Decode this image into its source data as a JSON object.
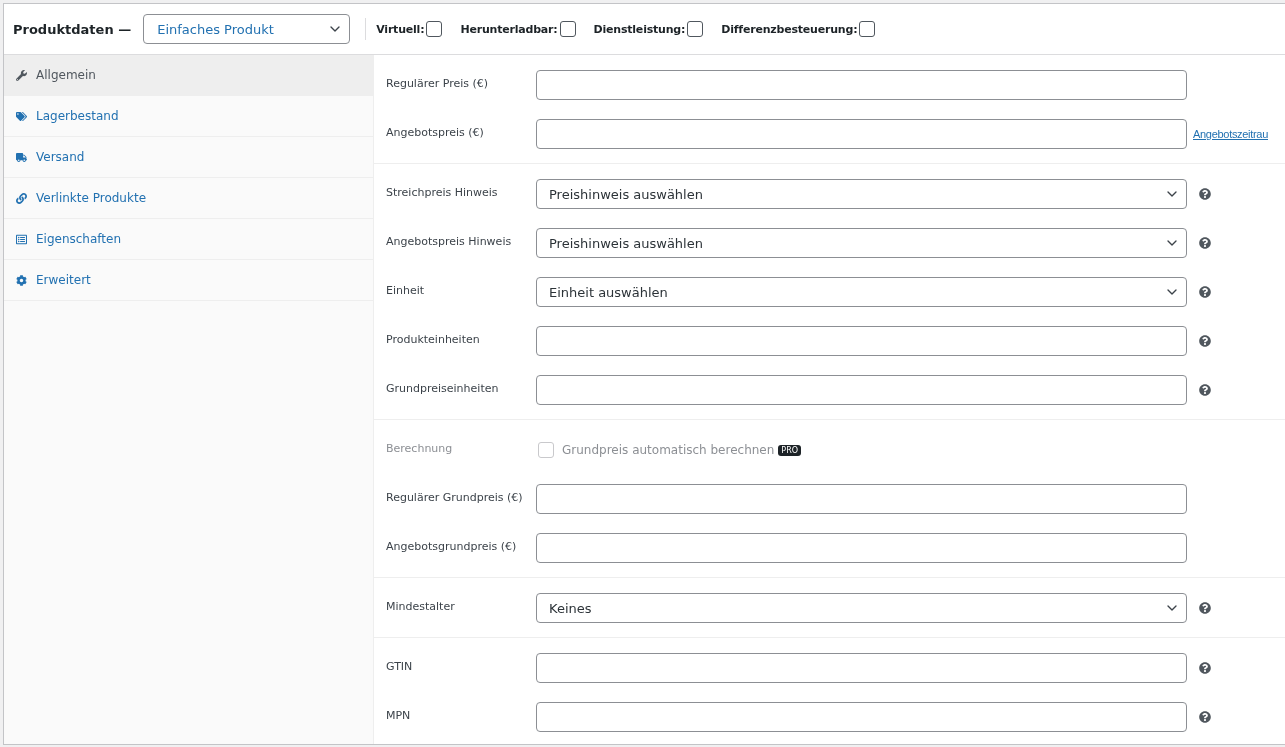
{
  "header": {
    "title": "Produktdaten —",
    "product_type": "Einfaches Produkt",
    "options": [
      {
        "label": "Virtuell:",
        "checked": false
      },
      {
        "label": "Herunterladbar:",
        "checked": false
      },
      {
        "label": "Dienstleistung:",
        "checked": false
      },
      {
        "label": "Differenzbesteuerung:",
        "checked": false
      }
    ]
  },
  "sidebar": {
    "items": [
      {
        "label": "Allgemein",
        "selected": true
      },
      {
        "label": "Lagerbestand",
        "selected": false
      },
      {
        "label": "Versand",
        "selected": false
      },
      {
        "label": "Verlinkte Produkte",
        "selected": false
      },
      {
        "label": "Eigenschaften",
        "selected": false
      },
      {
        "label": "Erweitert",
        "selected": false
      }
    ]
  },
  "groups": [
    {
      "rows": [
        {
          "kind": "text",
          "label": "Regulärer Preis (€)",
          "help": false
        },
        {
          "kind": "text",
          "label": "Angebotspreis (€)",
          "help": false,
          "link": "Angebotszeitrau"
        }
      ]
    },
    {
      "rows": [
        {
          "kind": "select",
          "label": "Streichpreis Hinweis",
          "value": "Preishinweis auswählen",
          "help": true
        },
        {
          "kind": "select",
          "label": "Angebotspreis Hinweis",
          "value": "Preishinweis auswählen",
          "help": true
        },
        {
          "kind": "select",
          "label": "Einheit",
          "value": "Einheit auswählen",
          "help": true
        },
        {
          "kind": "text",
          "label": "Produkteinheiten",
          "help": true
        },
        {
          "kind": "text",
          "label": "Grundpreiseinheiten",
          "help": true
        }
      ]
    },
    {
      "rows": [
        {
          "kind": "checkbox",
          "label": "Berechnung",
          "text": "Grundpreis automatisch berechnen",
          "badge": "PRO",
          "checked": false,
          "disabled": true
        },
        {
          "kind": "text",
          "label": "Regulärer Grundpreis (€)",
          "help": false
        },
        {
          "kind": "text",
          "label": "Angebotsgrundpreis (€)",
          "help": false
        }
      ]
    },
    {
      "rows": [
        {
          "kind": "select",
          "label": "Mindestalter",
          "value": "Keines",
          "help": true
        }
      ]
    },
    {
      "rows": [
        {
          "kind": "text",
          "label": "GTIN",
          "help": true
        },
        {
          "kind": "text",
          "label": "MPN",
          "help": true
        }
      ]
    }
  ]
}
